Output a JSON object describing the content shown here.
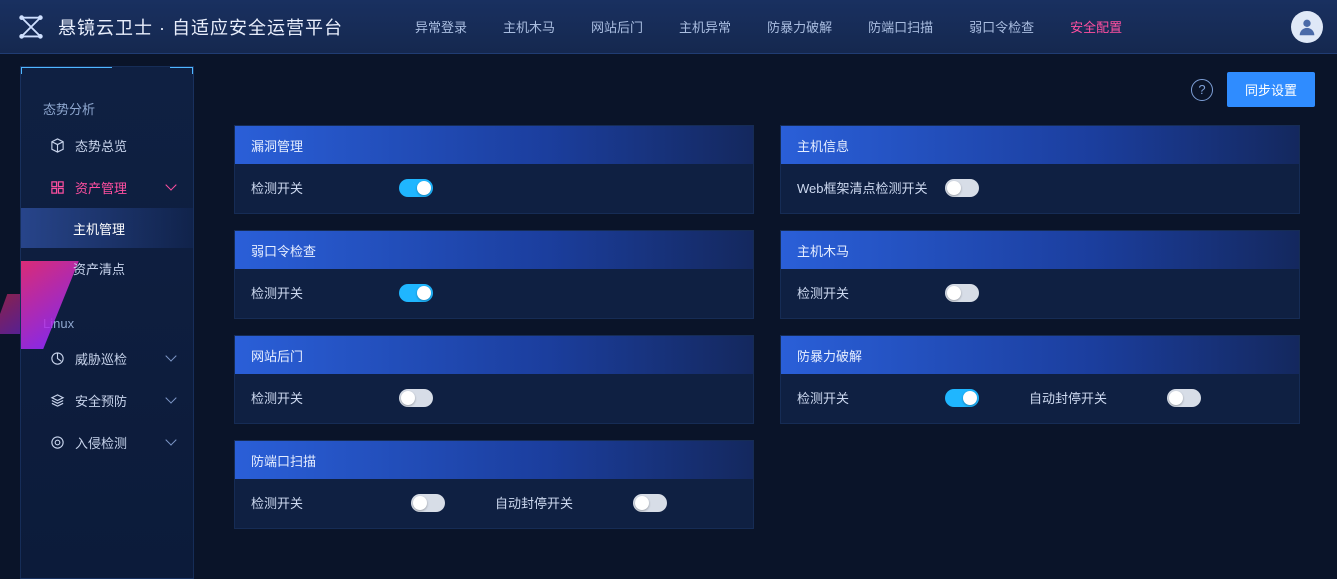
{
  "brand": "悬镜云卫士 · 自适应安全运营平台",
  "topnav": {
    "items": [
      {
        "label": "异常登录"
      },
      {
        "label": "主机木马"
      },
      {
        "label": "网站后门"
      },
      {
        "label": "主机异常"
      },
      {
        "label": "防暴力破解"
      },
      {
        "label": "防端口扫描"
      },
      {
        "label": "弱口令检查"
      },
      {
        "label": "安全配置",
        "active": true
      }
    ]
  },
  "sidebar": {
    "section1_title": "态势分析",
    "overview": "态势总览",
    "asset_mgmt": "资产管理",
    "host_mgmt": "主机管理",
    "asset_inventory": "资产清点",
    "section2_title": "Linux",
    "threat_patrol": "威胁巡检",
    "security_prevent": "安全预防",
    "intrusion_detect": "入侵检测"
  },
  "toolbar": {
    "help": "?",
    "sync": "同步设置"
  },
  "panels": {
    "vuln": {
      "title": "漏洞管理",
      "switch_label": "检测开关",
      "on": true
    },
    "host_info": {
      "title": "主机信息",
      "switch_label": "Web框架清点检测开关",
      "on": false
    },
    "weak_pwd": {
      "title": "弱口令检查",
      "switch_label": "检测开关",
      "on": true
    },
    "host_trojan": {
      "title": "主机木马",
      "switch_label": "检测开关",
      "on": false
    },
    "web_backdoor": {
      "title": "网站后门",
      "switch_label": "检测开关",
      "on": false
    },
    "brute_force": {
      "title": "防暴力破解",
      "switch_label": "检测开关",
      "on": true,
      "switch2_label": "自动封停开关",
      "on2": false
    },
    "port_scan": {
      "title": "防端口扫描",
      "switch_label": "检测开关",
      "on": false,
      "switch2_label": "自动封停开关",
      "on2": false
    }
  }
}
